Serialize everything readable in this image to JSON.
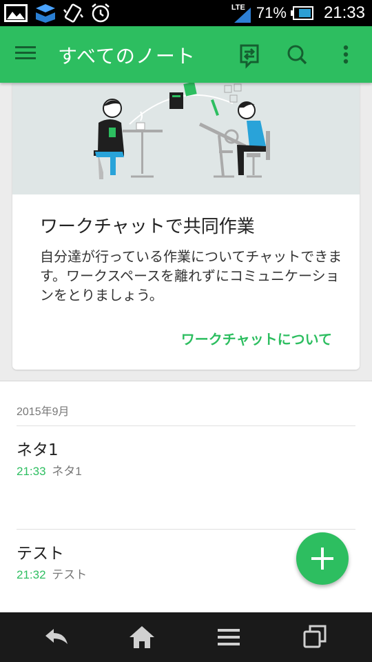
{
  "status_bar": {
    "network": "LTE",
    "battery_percent": "71%",
    "time": "21:33",
    "icons": [
      "gallery-icon",
      "dropbox-icon",
      "vibrate-icon",
      "alarm-icon",
      "signal-icon",
      "battery-icon"
    ]
  },
  "app_bar": {
    "title": "すべてのノート",
    "icons": [
      "menu-icon",
      "sync-icon",
      "search-icon",
      "more-vert-icon"
    ]
  },
  "promo_card": {
    "title": "ワークチャットで共同作業",
    "body": "自分達が行っている作業についてチャットできます。ワークスペースを離れずにコミュニケーションをとりましょう。",
    "link": "ワークチャットについて"
  },
  "notes": {
    "section": "2015年9月",
    "items": [
      {
        "title": "ネタ1",
        "time": "21:33",
        "snippet": "ネタ1"
      },
      {
        "title": "テスト",
        "time": "21:32",
        "snippet": "テスト"
      }
    ]
  },
  "colors": {
    "accent": "#2dbe60",
    "app_bar": "#2dbe60",
    "nav_bar": "#1a1a1a"
  },
  "nav_bar": {
    "icons": [
      "back-icon",
      "home-icon",
      "menu-icon",
      "recent-apps-icon"
    ]
  }
}
